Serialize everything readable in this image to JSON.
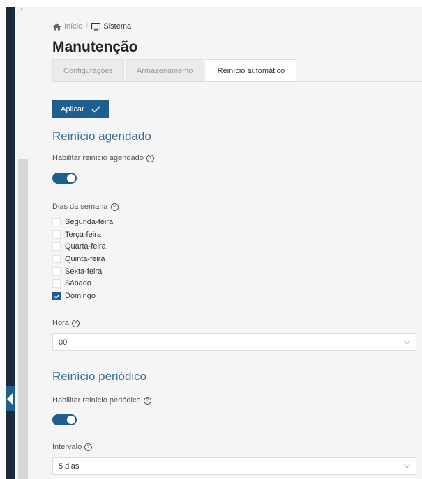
{
  "breadcrumb": {
    "home": "Início",
    "separator": "/",
    "current": "Sistema",
    "home_icon": "home-icon",
    "current_icon": "monitor-icon"
  },
  "page": {
    "title": "Manutenção"
  },
  "tabs": [
    {
      "label": "Configurações"
    },
    {
      "label": "Armazenamento"
    },
    {
      "label": "Reinício automático",
      "active": true
    }
  ],
  "actions": {
    "apply_label": "Aplicar"
  },
  "scheduled": {
    "title": "Reinício agendado",
    "enable_label": "Habilitar reinício agendado",
    "enabled": true,
    "days_label": "Dias da semana",
    "days": [
      {
        "label": "Segunda-feira",
        "checked": false
      },
      {
        "label": "Terça-feira",
        "checked": false
      },
      {
        "label": "Quarta-feira",
        "checked": false
      },
      {
        "label": "Quinta-feira",
        "checked": false
      },
      {
        "label": "Sexta-feira",
        "checked": false
      },
      {
        "label": "Sábado",
        "checked": false
      },
      {
        "label": "Domingo",
        "checked": true
      }
    ],
    "hour_label": "Hora",
    "hour_value": "00"
  },
  "periodic": {
    "title": "Reinício periódico",
    "enable_label": "Habilitar reinício periódico",
    "enabled": true,
    "interval_label": "Intervalo",
    "interval_value": "5 dias"
  },
  "colors": {
    "accent": "#1f5f8f",
    "section_title": "#3c6f93",
    "sidebar": "#1a2a38"
  },
  "help_glyph": "?"
}
